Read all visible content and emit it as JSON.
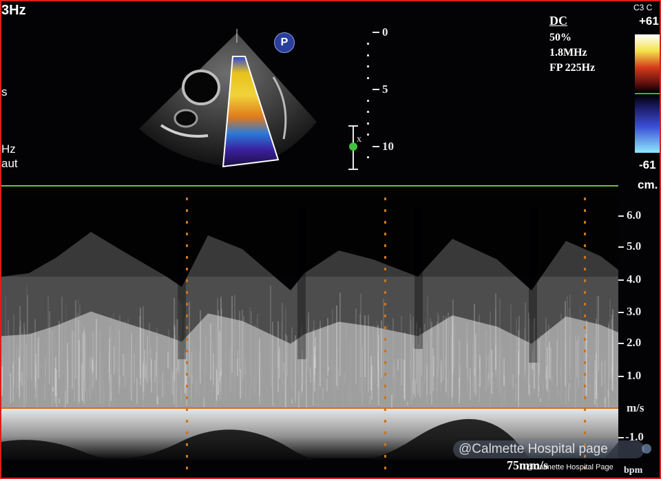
{
  "header": {
    "freq_left": "3Hz",
    "left_mid_1": "s",
    "left_mid_2": "Hz",
    "left_mid_3": "aut",
    "probe_badge": "P",
    "depth_marks": [
      "0",
      "5",
      "10"
    ],
    "gate_marker": "x"
  },
  "params": {
    "mode": "DC",
    "power": "50%",
    "frequency": "1.8MHz",
    "filter": "FP 225Hz"
  },
  "color_bar": {
    "label_top": "C3 C",
    "max": "+61",
    "min": "-61",
    "unit": "cm."
  },
  "velocity_scale": {
    "labels": [
      "6.0",
      "5.0",
      "4.0",
      "3.0",
      "2.0",
      "1.0",
      "m/s",
      "-1.0"
    ],
    "unit_bottom": "bpm"
  },
  "footer": {
    "sweep_speed": "75mm/s",
    "watermark": "@Calmette Hospital page",
    "watermark_small": "@Calmette Hospital Page"
  },
  "colors": {
    "frame": "#d8201c",
    "baseline": "#c8741f",
    "separator": "#6fbf3a"
  }
}
